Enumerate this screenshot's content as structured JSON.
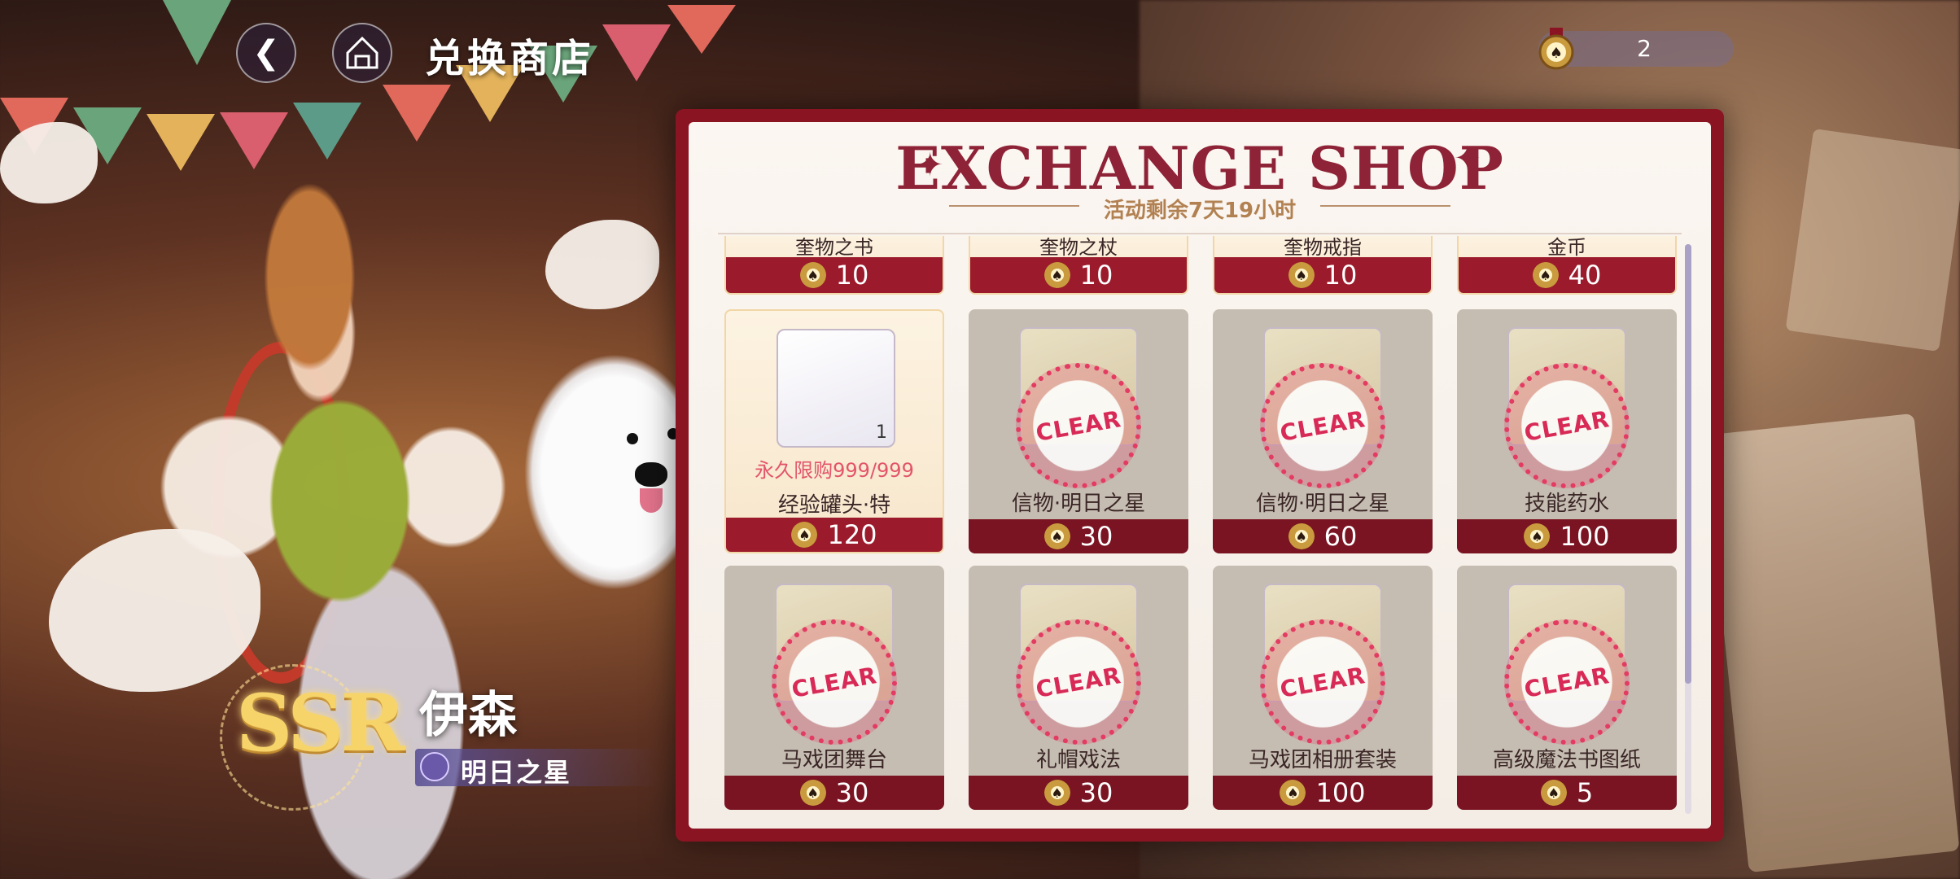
{
  "header": {
    "back_icon": "chevron-left-icon",
    "shop_icon": "tent-icon",
    "title": "兑换商店",
    "currency": {
      "icon": "medal-coin-icon",
      "value": "2"
    }
  },
  "character": {
    "rarity": "SSR",
    "name": "伊森",
    "card_title": "明日之星"
  },
  "shop": {
    "heading": "EXCHANGE SHOP",
    "countdown": "活动剩余7天19小时",
    "sold_out_stamp": "CLEAR",
    "partial_row": [
      {
        "name": "奎物之书",
        "price": "10"
      },
      {
        "name": "奎物之杖",
        "price": "10"
      },
      {
        "name": "奎物戒指",
        "price": "10"
      },
      {
        "name": "金币",
        "price": "40"
      }
    ],
    "row1": [
      {
        "name": "经验罐头·特",
        "price": "120",
        "limit": "永久限购999/999",
        "qty": "1",
        "sold_out": false
      },
      {
        "name": "信物·明日之星",
        "price": "30",
        "sold_out": true
      },
      {
        "name": "信物·明日之星",
        "price": "60",
        "sold_out": true
      },
      {
        "name": "技能药水",
        "price": "100",
        "sold_out": true
      }
    ],
    "row2": [
      {
        "name": "马戏团舞台",
        "price": "30",
        "sold_out": true
      },
      {
        "name": "礼帽戏法",
        "price": "30",
        "sold_out": true
      },
      {
        "name": "马戏团相册套装",
        "price": "100",
        "sold_out": true
      },
      {
        "name": "高级魔法书图纸",
        "price": "5",
        "sold_out": true
      }
    ]
  },
  "colors": {
    "panel_border": "#8b1423",
    "price_bar": "#9b1a2b",
    "heading": "#8e2236",
    "stamp": "#e33b62"
  }
}
